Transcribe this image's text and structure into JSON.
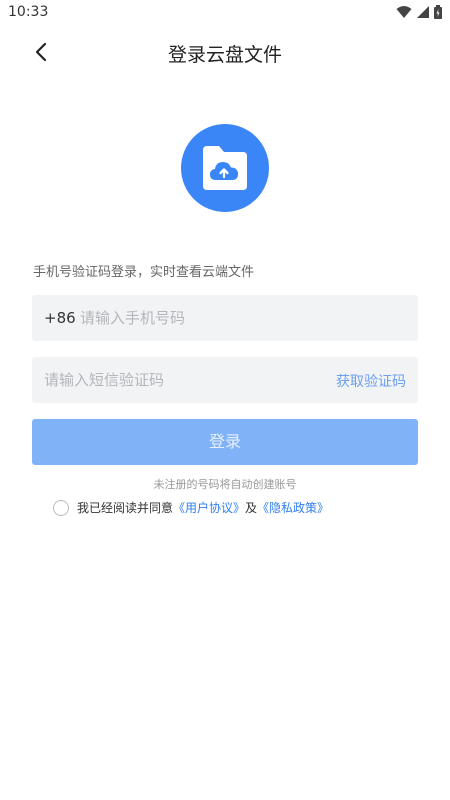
{
  "status_bar": {
    "time": "10:33"
  },
  "header": {
    "title": "登录云盘文件"
  },
  "subtitle": "手机号验证码登录，实时查看云端文件",
  "phone_field": {
    "prefix": "+86",
    "placeholder": "请输入手机号码"
  },
  "code_field": {
    "placeholder": "请输入短信验证码",
    "get_code_label": "获取验证码"
  },
  "login_button": "登录",
  "auto_register_hint": "未注册的号码将自动创建账号",
  "agreement": {
    "text": "我已经阅读并同意",
    "user_agreement": "《用户协议》",
    "and": "及",
    "privacy_policy": "《隐私政策》"
  },
  "colors": {
    "accent": "#3b86f7",
    "button_disabled": "#80b2f8",
    "link": "#2f7ef0"
  }
}
